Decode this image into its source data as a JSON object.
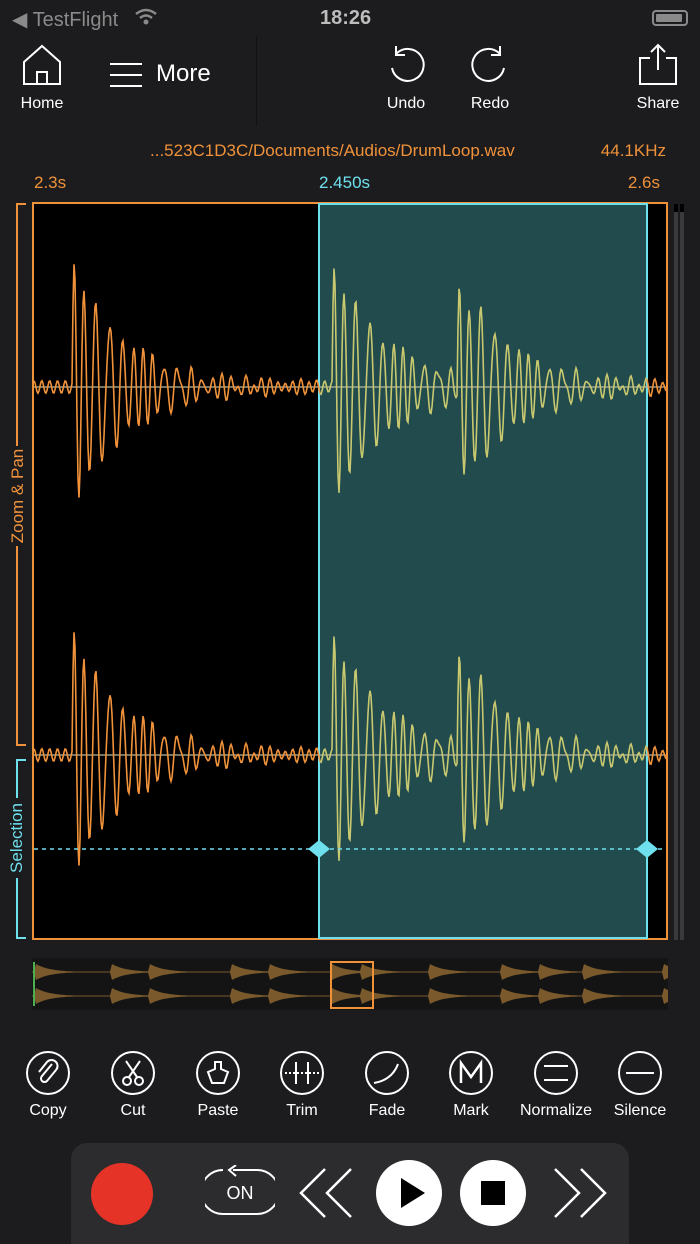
{
  "status_bar": {
    "back_app": "TestFlight",
    "time": "18:26"
  },
  "toolbar": {
    "home_label": "Home",
    "more_label": "More",
    "undo_label": "Undo",
    "redo_label": "Redo",
    "share_label": "Share"
  },
  "file": {
    "path": "...523C1D3C/Documents/Audios/DrumLoop.wav",
    "sample_rate": "44.1KHz"
  },
  "timeline": {
    "start": "2.3s",
    "cursor": "2.450s",
    "end": "2.6s"
  },
  "side_labels": {
    "zoom_pan": "Zoom & Pan",
    "selection": "Selection"
  },
  "actions": [
    {
      "label": "Copy"
    },
    {
      "label": "Cut"
    },
    {
      "label": "Paste"
    },
    {
      "label": "Trim"
    },
    {
      "label": "Fade"
    },
    {
      "label": "Mark"
    },
    {
      "label": "Normalize"
    },
    {
      "label": "Silence"
    }
  ],
  "transport": {
    "loop_label": "ON"
  },
  "colors": {
    "accent": "#f0923a",
    "selection": "#6ee0ee",
    "selection_fill": "#214b4c",
    "record": "#e53427"
  }
}
